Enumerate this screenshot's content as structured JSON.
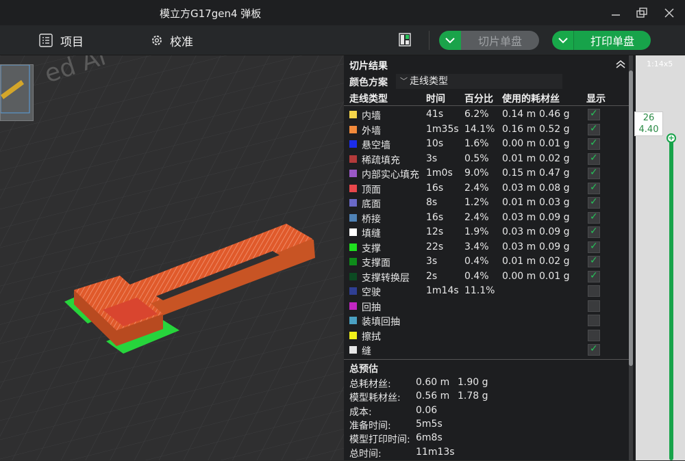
{
  "window": {
    "title": "模立方G17gen4 弹板"
  },
  "toolbar": {
    "project_label": "项目",
    "calibrate_label": "校准",
    "slice_label": "切片单盘",
    "print_label": "打印单盘",
    "slice_enabled": false
  },
  "icons": {
    "project": "list-icon",
    "calibrate": "gear-icon",
    "viewer": "layout-icon",
    "dropdown": "chevron-down-icon",
    "collapse": "double-chevron-up-icon",
    "check": "check-icon"
  },
  "colors": {
    "accent_green": "#17a34a",
    "panel_bg": "#1c1d1f",
    "viewport_bg": "#2b2b2b",
    "model_orange": "#e8652a",
    "support_green": "#27d43c"
  },
  "slice_panel": {
    "header": "切片结果",
    "scheme_label": "颜色方案",
    "scheme_value": "走线类型",
    "columns": {
      "type": "走线类型",
      "time": "时间",
      "percent": "百分比",
      "filament": "使用的耗材丝",
      "display": "显示"
    },
    "rows": [
      {
        "name": "内墙",
        "color": "#f5d54a",
        "time": "41s",
        "percent": "6.2%",
        "length": "0.14 m",
        "weight": "0.46 g",
        "show": true
      },
      {
        "name": "外墙",
        "color": "#f28a3b",
        "time": "1m35s",
        "percent": "14.1%",
        "length": "0.16 m",
        "weight": "0.52 g",
        "show": true
      },
      {
        "name": "悬空墙",
        "color": "#1c2dea",
        "time": "10s",
        "percent": "1.6%",
        "length": "0.00 m",
        "weight": "0.01 g",
        "show": true
      },
      {
        "name": "稀疏填充",
        "color": "#b33a3a",
        "time": "3s",
        "percent": "0.5%",
        "length": "0.01 m",
        "weight": "0.02 g",
        "show": true
      },
      {
        "name": "内部实心填充",
        "color": "#9a58c7",
        "time": "1m0s",
        "percent": "9.0%",
        "length": "0.15 m",
        "weight": "0.47 g",
        "show": true
      },
      {
        "name": "顶面",
        "color": "#e8474b",
        "time": "16s",
        "percent": "2.4%",
        "length": "0.03 m",
        "weight": "0.08 g",
        "show": true
      },
      {
        "name": "底面",
        "color": "#6a69c8",
        "time": "8s",
        "percent": "1.2%",
        "length": "0.01 m",
        "weight": "0.03 g",
        "show": true
      },
      {
        "name": "桥接",
        "color": "#4f82b6",
        "time": "16s",
        "percent": "2.4%",
        "length": "0.03 m",
        "weight": "0.09 g",
        "show": true
      },
      {
        "name": "填缝",
        "color": "#ffffff",
        "time": "12s",
        "percent": "1.9%",
        "length": "0.03 m",
        "weight": "0.09 g",
        "show": true
      },
      {
        "name": "支撑",
        "color": "#1fe01f",
        "time": "22s",
        "percent": "3.4%",
        "length": "0.03 m",
        "weight": "0.09 g",
        "show": true
      },
      {
        "name": "支撑面",
        "color": "#0e8c1a",
        "time": "3s",
        "percent": "0.4%",
        "length": "0.01 m",
        "weight": "0.02 g",
        "show": true
      },
      {
        "name": "支撑转换层",
        "color": "#0c4a22",
        "time": "2s",
        "percent": "0.4%",
        "length": "0.00 m",
        "weight": "0.01 g",
        "show": true
      },
      {
        "name": "空驶",
        "color": "#2f3f93",
        "time": "1m14s",
        "percent": "11.1%",
        "length": "",
        "weight": "",
        "show": false
      },
      {
        "name": "回抽",
        "color": "#c226c2",
        "time": "",
        "percent": "",
        "length": "",
        "weight": "",
        "show": false
      },
      {
        "name": "装填回抽",
        "color": "#4aa0c2",
        "time": "",
        "percent": "",
        "length": "",
        "weight": "",
        "show": false
      },
      {
        "name": "擦拭",
        "color": "#f0f01a",
        "time": "",
        "percent": "",
        "length": "",
        "weight": "",
        "show": false
      },
      {
        "name": "缝",
        "color": "#e6e6e6",
        "time": "",
        "percent": "",
        "length": "",
        "weight": "",
        "show": true
      }
    ],
    "summary": {
      "title": "总预估",
      "items": [
        {
          "label": "总耗材丝:",
          "v1": "0.60 m",
          "v2": "1.90 g"
        },
        {
          "label": "模型耗材丝:",
          "v1": "0.56 m",
          "v2": "1.78 g"
        },
        {
          "label": "成本:",
          "v1": "0.06",
          "v2": ""
        },
        {
          "label": "准备时间:",
          "v1": "5m5s",
          "v2": ""
        },
        {
          "label": "模型打印时间:",
          "v1": "6m8s",
          "v2": ""
        },
        {
          "label": "总时间:",
          "v1": "11m13s",
          "v2": ""
        }
      ]
    }
  },
  "layer_slider": {
    "layer": "26",
    "height": "4.40",
    "top_text": "1:14x5"
  }
}
